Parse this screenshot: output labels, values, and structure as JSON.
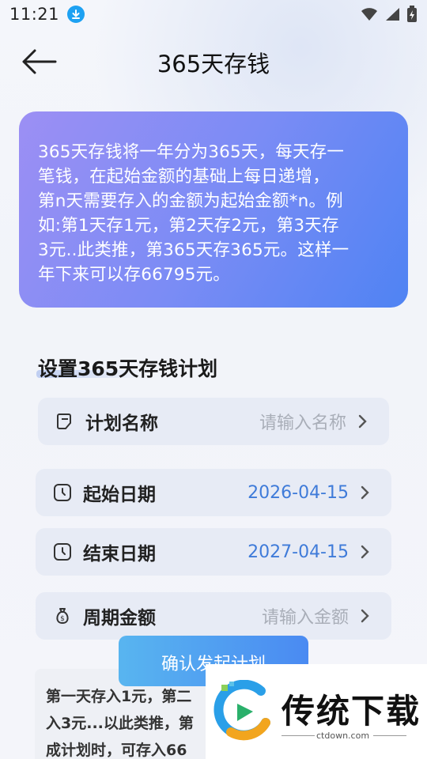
{
  "status_bar": {
    "time": "11:21"
  },
  "header": {
    "title": "365天存钱"
  },
  "info_card": {
    "lines": [
      "365天存钱将一年分为365天，每天存一",
      "笔钱，在起始金额的基础上每日递增，",
      "第n天需要存入的金额为起始金额*n。例",
      "如:第1天存1元，第2天存2元，第3天存",
      "3元..此类推，第365天存365元。这样一",
      "年下来可以存66795元。"
    ]
  },
  "section": {
    "title": "设置365天存钱计划"
  },
  "form": {
    "plan_name": {
      "label": "计划名称",
      "placeholder": "请输入名称"
    },
    "start_date": {
      "label": "起始日期",
      "value": "2026-04-15"
    },
    "end_date": {
      "label": "结束日期",
      "value": "2027-04-15"
    },
    "amount": {
      "label": "周期金额",
      "placeholder": "请输入金额"
    }
  },
  "confirm_button": {
    "label": "确认发起计划"
  },
  "note": {
    "lines": [
      "第一天存入1元，第二",
      "入3元...以此类推，第",
      "成计划时，可存入66"
    ]
  },
  "watermark": {
    "title": "传统下载",
    "subtitle": "ctdown.com"
  },
  "colors": {
    "accent": "#4f83f3",
    "card_gradient_start": "#9c8ff4",
    "date_blue": "#3f7bd9",
    "button_start": "#58b5f0",
    "button_end": "#4a8af2"
  }
}
